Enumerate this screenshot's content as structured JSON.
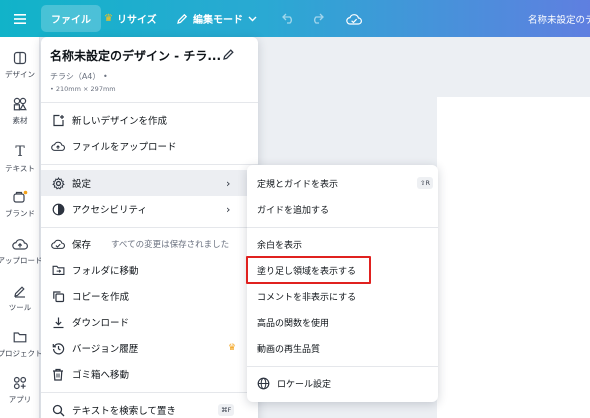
{
  "topbar": {
    "menu_icon": "hamburger-icon",
    "file_label": "ファイル",
    "resize_label": "リサイズ",
    "edit_mode_label": "編集モード",
    "doc_title": "名称未設定のデ"
  },
  "rail": {
    "items": [
      {
        "label": "デザイン",
        "icon": "design-icon"
      },
      {
        "label": "素材",
        "icon": "elements-icon"
      },
      {
        "label": "テキスト",
        "icon": "text-icon"
      },
      {
        "label": "ブランド",
        "icon": "brand-icon"
      },
      {
        "label": "アップロード",
        "icon": "upload-icon"
      },
      {
        "label": "ツール",
        "icon": "tools-icon"
      },
      {
        "label": "プロジェクト",
        "icon": "folder-icon"
      },
      {
        "label": "アプリ",
        "icon": "apps-icon"
      }
    ]
  },
  "file_menu": {
    "title": "名称未設定のデザイン - チラ...",
    "doc_type": "チラシ（A4）  •",
    "doc_size": "• 210mm × 297mm",
    "items": [
      {
        "label": "新しいデザインを作成",
        "icon": "new-design-icon"
      },
      {
        "label": "ファイルをアップロード",
        "icon": "cloud-upload-icon"
      },
      {
        "label": "設定",
        "icon": "gear-icon"
      },
      {
        "label": "アクセシビリティ",
        "icon": "accessibility-icon"
      },
      {
        "label": "保存",
        "icon": "cloud-check-icon",
        "note": "すべての変更は保存されました"
      },
      {
        "label": "フォルダに移動",
        "icon": "folder-icon"
      },
      {
        "label": "コピーを作成",
        "icon": "copy-icon"
      },
      {
        "label": "ダウンロード",
        "icon": "download-icon"
      },
      {
        "label": "バージョン履歴",
        "icon": "history-icon"
      },
      {
        "label": "ゴミ箱へ移動",
        "icon": "trash-icon"
      },
      {
        "label": "テキストを検索して置き",
        "icon": "search-icon",
        "shortcut": "⌘F"
      }
    ]
  },
  "sub_menu": {
    "items": [
      {
        "label": "定規とガイドを表示",
        "shortcut": "⇧R"
      },
      {
        "label": "ガイドを追加する"
      },
      {
        "label": "余白を表示"
      },
      {
        "label": "塗り足し領域を表示する"
      },
      {
        "label": "コメントを非表示にする"
      },
      {
        "label": "高品の関数を使用"
      },
      {
        "label": "動画の再生品質"
      },
      {
        "label": "ロケール設定",
        "icon": "globe-icon"
      }
    ]
  }
}
